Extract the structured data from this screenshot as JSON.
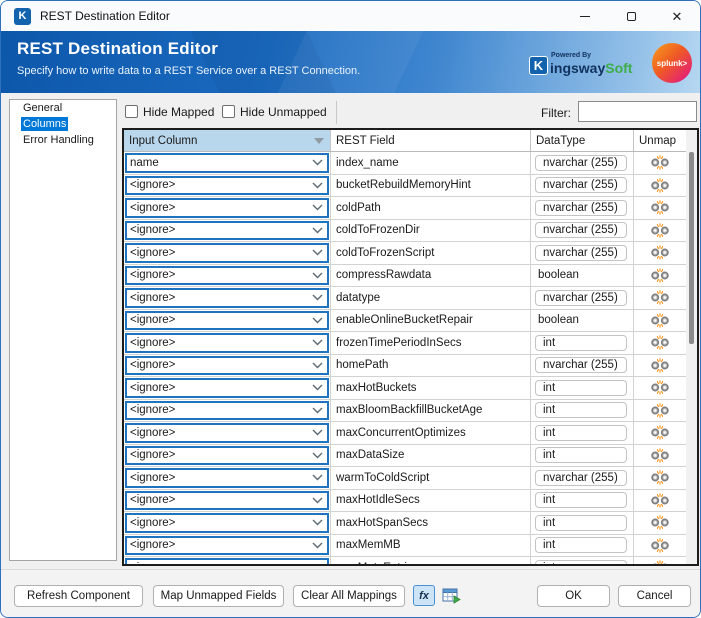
{
  "window": {
    "title": "REST Destination Editor"
  },
  "titlebar": {
    "app_icon_letter": "K"
  },
  "header": {
    "title": "REST Destination Editor",
    "subtitle": "Specify how to write data to a REST Service over a REST Connection.",
    "powered_by": "Powered By",
    "brand_k": "K",
    "brand_ingsway": "ingsway",
    "brand_soft": "Soft",
    "splunk_label": "splunk>"
  },
  "sidebar": {
    "items": [
      {
        "label": "General",
        "selected": false
      },
      {
        "label": "Columns",
        "selected": true
      },
      {
        "label": "Error Handling",
        "selected": false
      }
    ]
  },
  "toolbar": {
    "hide_mapped_label": "Hide Mapped",
    "hide_mapped_checked": false,
    "hide_unmapped_label": "Hide Unmapped",
    "hide_unmapped_checked": false,
    "filter_label": "Filter:",
    "filter_value": ""
  },
  "table": {
    "headers": [
      "Input Column",
      "REST Field",
      "DataType",
      "Unmap"
    ],
    "rows": [
      {
        "input": "name",
        "rest_field": "index_name",
        "datatype": "nvarchar (255)",
        "boxed": true
      },
      {
        "input": "<ignore>",
        "rest_field": "bucketRebuildMemoryHint",
        "datatype": "nvarchar (255)",
        "boxed": true
      },
      {
        "input": "<ignore>",
        "rest_field": "coldPath",
        "datatype": "nvarchar (255)",
        "boxed": true
      },
      {
        "input": "<ignore>",
        "rest_field": "coldToFrozenDir",
        "datatype": "nvarchar (255)",
        "boxed": true
      },
      {
        "input": "<ignore>",
        "rest_field": "coldToFrozenScript",
        "datatype": "nvarchar (255)",
        "boxed": true
      },
      {
        "input": "<ignore>",
        "rest_field": "compressRawdata",
        "datatype": "boolean",
        "boxed": false
      },
      {
        "input": "<ignore>",
        "rest_field": "datatype",
        "datatype": "nvarchar (255)",
        "boxed": true
      },
      {
        "input": "<ignore>",
        "rest_field": "enableOnlineBucketRepair",
        "datatype": "boolean",
        "boxed": false
      },
      {
        "input": "<ignore>",
        "rest_field": "frozenTimePeriodInSecs",
        "datatype": "int",
        "boxed": true
      },
      {
        "input": "<ignore>",
        "rest_field": "homePath",
        "datatype": "nvarchar (255)",
        "boxed": true
      },
      {
        "input": "<ignore>",
        "rest_field": "maxHotBuckets",
        "datatype": "int",
        "boxed": true
      },
      {
        "input": "<ignore>",
        "rest_field": "maxBloomBackfillBucketAge",
        "datatype": "int",
        "boxed": true
      },
      {
        "input": "<ignore>",
        "rest_field": "maxConcurrentOptimizes",
        "datatype": "int",
        "boxed": true
      },
      {
        "input": "<ignore>",
        "rest_field": "maxDataSize",
        "datatype": "int",
        "boxed": true
      },
      {
        "input": "<ignore>",
        "rest_field": "warmToColdScript",
        "datatype": "nvarchar (255)",
        "boxed": true
      },
      {
        "input": "<ignore>",
        "rest_field": "maxHotIdleSecs",
        "datatype": "int",
        "boxed": true
      },
      {
        "input": "<ignore>",
        "rest_field": "maxHotSpanSecs",
        "datatype": "int",
        "boxed": true
      },
      {
        "input": "<ignore>",
        "rest_field": "maxMemMB",
        "datatype": "int",
        "boxed": true
      },
      {
        "input": "<ignore>",
        "rest_field": "maxMetaEntries",
        "datatype": "int",
        "boxed": true
      }
    ]
  },
  "footer": {
    "refresh_label": "Refresh Component",
    "map_label": "Map Unmapped Fields",
    "clear_label": "Clear All Mappings",
    "fx_label": "fx",
    "ok_label": "OK",
    "cancel_label": "Cancel"
  },
  "colors": {
    "accent_blue": "#0078d7",
    "header_gradient_start": "#0d57aa",
    "header_gradient_end": "#b6d7f1",
    "combo_border": "#2073bf",
    "header_cell_blue": "#b8d6ec",
    "kingsway_navy": "#12325e",
    "kingsway_green": "#3fae49",
    "splunk_orange": "#f8a01a",
    "splunk_pink": "#e2108c",
    "unmap_spark_orange": "#f29111"
  }
}
